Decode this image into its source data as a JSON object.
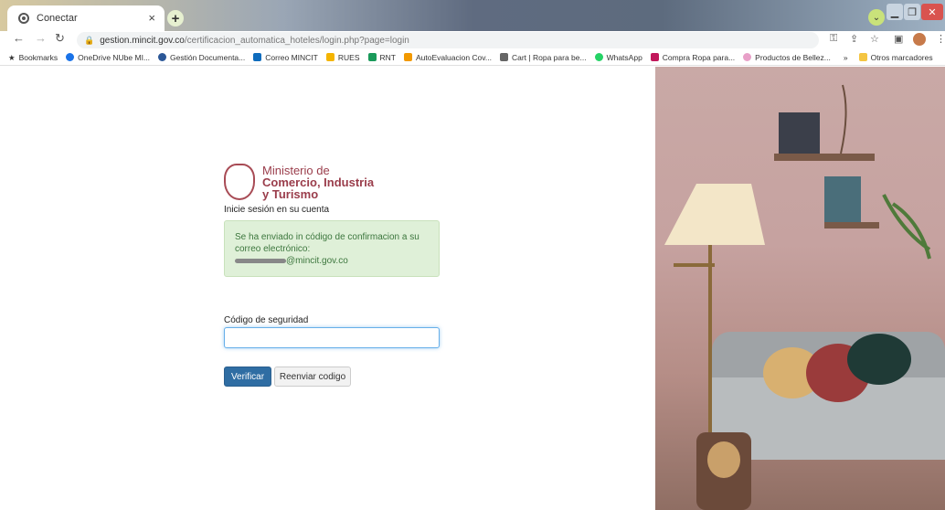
{
  "browser": {
    "tab_title": "Conectar",
    "tab_close": "×",
    "new_tab": "+",
    "url_domain": "gestion.mincit.gov.co",
    "url_path": "/certificacion_automatica_hoteles/login.php?page=login"
  },
  "bookmarks": {
    "items": [
      {
        "label": "Bookmarks",
        "color": "#333333"
      },
      {
        "label": "OneDrive NUbe MI...",
        "color": "#1a73e8"
      },
      {
        "label": "Gestión Documenta...",
        "color": "#2b5797"
      },
      {
        "label": "Correo MINCIT",
        "color": "#0f6cbd"
      },
      {
        "label": "RUES",
        "color": "#f4b400"
      },
      {
        "label": "RNT",
        "color": "#1a9a5a"
      },
      {
        "label": "AutoEvaluacion Cov...",
        "color": "#f29900"
      },
      {
        "label": "Cart | Ropa para be...",
        "color": "#666666"
      },
      {
        "label": "WhatsApp",
        "color": "#25d366"
      },
      {
        "label": "Compra Ropa para...",
        "color": "#c2185b"
      },
      {
        "label": "Productos de Bellez...",
        "color": "#e8a0c8"
      }
    ],
    "more": "»",
    "other_label": "Otros marcadores"
  },
  "login": {
    "ministry_line1": "Ministerio de",
    "ministry_line2": "Comercio, Industria",
    "ministry_line3": "y Turismo",
    "subtitle": "Inicie sesión en su cuenta",
    "alert_line1": "Se ha enviado in código de confirmacion a su",
    "alert_line2": "correo electrónico:",
    "alert_email": "@mincit.gov.co",
    "code_label": "Código de seguridad",
    "code_value": "",
    "verify_button": "Verificar",
    "resend_button": "Reenviar codigo"
  },
  "colors": {
    "brand": "#9a3d4b",
    "primary_button": "#2f6da3",
    "alert_bg": "#dff0d8"
  }
}
